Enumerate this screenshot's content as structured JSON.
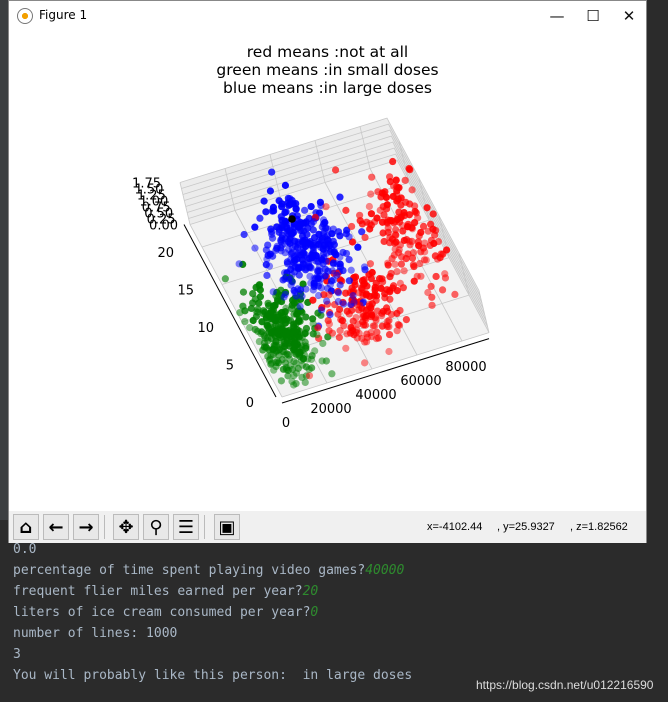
{
  "window": {
    "title": "Figure 1",
    "minimize": "—",
    "maximize": "☐",
    "close": "✕"
  },
  "figure": {
    "title_lines": [
      "red means :not at all",
      "green means :in small doses",
      "blue means :in large doses"
    ]
  },
  "chart_data": {
    "type": "scatter",
    "projection": "3d",
    "title": "red means :not at all\ngreen means :in small doses\nblue means :in large doses",
    "x_ticks": [
      "0",
      "20000",
      "40000",
      "60000",
      "80000"
    ],
    "y_ticks": [
      "0",
      "5",
      "10",
      "15",
      "20"
    ],
    "z_ticks": [
      "0.00",
      "0.25",
      "0.50",
      "0.75",
      "1.00",
      "1.25",
      "1.50",
      "1.75"
    ],
    "xlim": [
      0,
      92000
    ],
    "ylim": [
      0,
      23
    ],
    "zlim": [
      0,
      1.75
    ],
    "grid": true,
    "clusters": [
      {
        "class": "not at all",
        "color": "#ff0000",
        "center": [
          78000,
          12.5
        ],
        "spread": [
          9000,
          3.5
        ],
        "count": 170
      },
      {
        "class": "not at all",
        "color": "#ff0000",
        "center": [
          45000,
          4.5
        ],
        "spread": [
          9000,
          2.2
        ],
        "count": 172
      },
      {
        "class": "in large doses",
        "color": "#0000ff",
        "center": [
          36000,
          13.5
        ],
        "spread": [
          9000,
          2.8
        ],
        "count": 327
      },
      {
        "class": "in small doses",
        "color": "#008000",
        "center": [
          11500,
          4.5
        ],
        "spread": [
          7000,
          2.6
        ],
        "count": 331
      }
    ],
    "query_point": {
      "x": 40000,
      "y": 20,
      "z": 0,
      "color": "#000000"
    }
  },
  "toolbar": {
    "home": "home",
    "back": "back",
    "forward": "forward",
    "pan": "pan",
    "zoom": "zoom",
    "configure": "configure",
    "save": "save",
    "coords": {
      "x": "x=-4102.44",
      "y": ", y=25.9327",
      "z": ", z=1.82562"
    }
  },
  "console": {
    "lines": [
      {
        "text": "0.0",
        "input": ""
      },
      {
        "text": "percentage of time spent playing video games?",
        "input": "40000"
      },
      {
        "text": "frequent flier miles earned per year?",
        "input": "20"
      },
      {
        "text": "liters of ice cream consumed per year?",
        "input": "0"
      },
      {
        "text": "number of lines: 1000",
        "input": ""
      },
      {
        "text": "3",
        "input": ""
      },
      {
        "text": "You will probably like this person:  in large doses",
        "input": ""
      }
    ]
  },
  "watermark": "https://blog.csdn.net/u012216590"
}
